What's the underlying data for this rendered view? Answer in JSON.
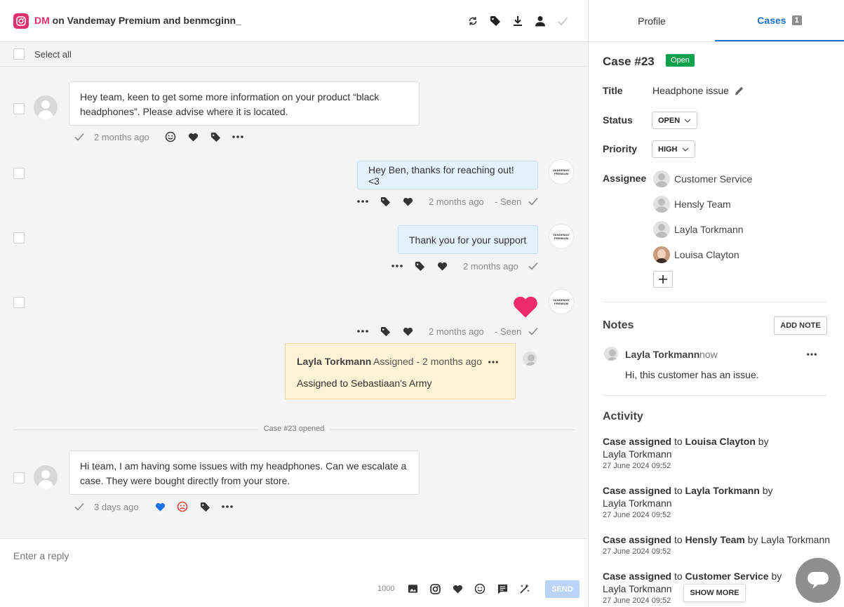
{
  "header": {
    "channel": "DM",
    "title_rest": "on Vandemay Premium and benmcginn_"
  },
  "select_all": "Select all",
  "brand_avatar_text": [
    "VANDEMAY",
    "PREMIUM"
  ],
  "messages": [
    {
      "text": "Hey team, keen to get some more information on your product “black headphones”. Please advise where it is located.",
      "time": "2 months ago"
    },
    {
      "text": "Hey Ben, thanks for reaching out! <3",
      "time": "2 months ago",
      "seen": "- Seen"
    },
    {
      "text": "Thank you for your support",
      "time": "2 months ago"
    },
    {
      "time": "2 months ago",
      "seen": "- Seen"
    },
    {
      "text": "Hi team, I am having some issues with my headphones. Can we escalate a case. They were bought directly from your store.",
      "time": "3 days ago"
    }
  ],
  "assignment": {
    "author": "Layla Torkmann",
    "meta": "Assigned - 2 months ago",
    "text": "Assigned to Sebastiaan's Army"
  },
  "case_divider": "Case #23 opened",
  "reply": {
    "placeholder": "Enter a reply",
    "char_count": "1000",
    "send_label": "SEND"
  },
  "tabs": {
    "profile": "Profile",
    "cases": "Cases",
    "cases_count": "1"
  },
  "case": {
    "id": "Case #23",
    "badge": "Open",
    "title_label": "Title",
    "title_value": "Headphone issue",
    "status_label": "Status",
    "status_value": "OPEN",
    "priority_label": "Priority",
    "priority_value": "HIGH",
    "assignee_label": "Assignee",
    "assignees": [
      "Customer Service",
      "Hensly Team",
      "Layla Torkmann",
      "Louisa Clayton"
    ]
  },
  "notes": {
    "heading": "Notes",
    "add_label": "ADD NOTE",
    "author": "Layla Torkmann",
    "time": "now",
    "text": "Hi, this customer has an issue."
  },
  "activity": {
    "heading": "Activity",
    "action": "Case assigned",
    "to": "to",
    "by": "by",
    "items": [
      {
        "target": "Louisa Clayton",
        "actor": "Layla Torkmann",
        "time": "27 June 2024 09:52"
      },
      {
        "target": "Layla Torkmann",
        "actor": "Layla Torkmann",
        "time": "27 June 2024 09:52"
      },
      {
        "target": "Hensly Team",
        "actor": "Layla Torkmann",
        "time": "27 June 2024 09:52"
      },
      {
        "target": "Customer Service",
        "actor": "Layla Torkmann",
        "time": "27 June 2024 09:52"
      }
    ],
    "show_more": "SHOW MORE"
  },
  "colors": {
    "instagram": "#e1306c",
    "accent": "#1a73c9",
    "open_green": "#0aa14c",
    "heart_red": "#ee2a6b"
  }
}
